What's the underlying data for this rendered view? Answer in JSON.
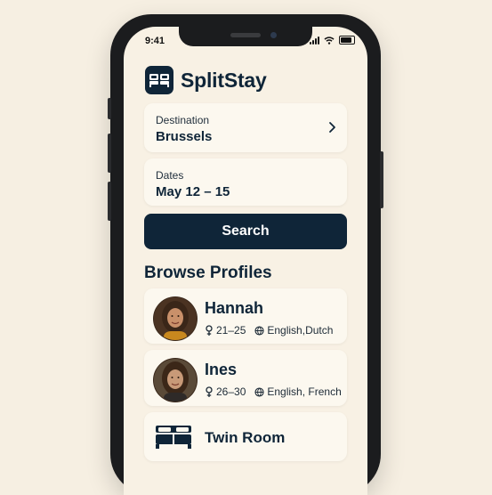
{
  "status_bar": {
    "time": "9:41"
  },
  "app": {
    "title": "SplitStay",
    "logo_icon": "bed-icon"
  },
  "destination": {
    "label": "Destination",
    "value": "Brussels"
  },
  "dates": {
    "label": "Dates",
    "value": "May 12 – 15"
  },
  "search_button": {
    "label": "Search"
  },
  "browse": {
    "title": "Browse Profiles",
    "profiles": [
      {
        "name": "Hannah",
        "age": "21–25",
        "languages": "English,Dutch"
      },
      {
        "name": "Ines",
        "age": "26–30",
        "languages": "English, French"
      }
    ],
    "room": {
      "label": "Twin Room",
      "icon": "twin-beds-icon"
    }
  },
  "colors": {
    "accent": "#0f2538",
    "background": "#f8f1e4",
    "card": "#fcf8ef"
  }
}
